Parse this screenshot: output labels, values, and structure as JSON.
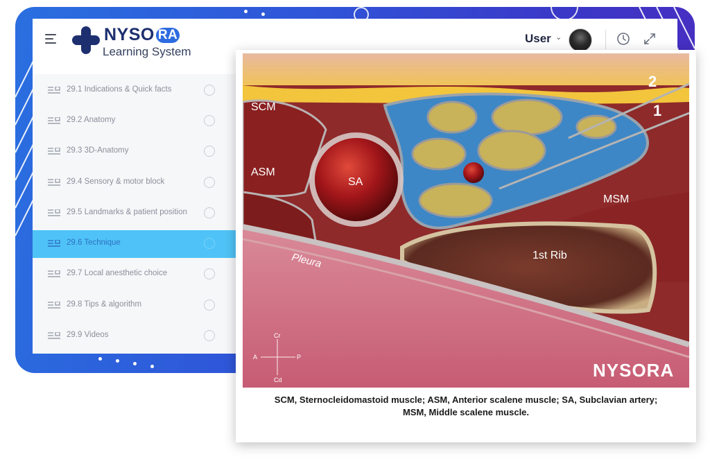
{
  "brand": {
    "name_prefix": "NYSO",
    "name_suffix": "RA",
    "subtitle": "Learning System"
  },
  "header": {
    "user_label": "User",
    "icons": [
      "menu-icon",
      "chevron-down-icon",
      "clock-icon",
      "expand-icon"
    ]
  },
  "sidebar": {
    "active_index": 5,
    "items": [
      {
        "label": "29.1 Indications & Quick facts"
      },
      {
        "label": "29.2 Anatomy"
      },
      {
        "label": "29.3 3D-Anatomy"
      },
      {
        "label": "29.4 Sensory & motor block"
      },
      {
        "label": "29.5 Landmarks & patient position"
      },
      {
        "label": "29.6 Technique"
      },
      {
        "label": "29.7 Local anesthetic choice"
      },
      {
        "label": "29.8 Tips & algorithm"
      },
      {
        "label": "29.9 Videos"
      }
    ]
  },
  "figure": {
    "labels": {
      "scm": "SCM",
      "asm": "ASM",
      "sa": "SA",
      "msm": "MSM",
      "pleura": "Pleura",
      "rib": "1st Rib",
      "needle1": "1",
      "needle2": "2",
      "watermark": "NYSORA",
      "orient_cr": "Cr",
      "orient_cd": "Cd",
      "orient_a": "A",
      "orient_p": "P"
    },
    "caption_line1": "SCM, Sternocleidomastoid muscle; ASM, Anterior scalene muscle; SA, Subclavian artery;",
    "caption_line2": "MSM, Middle scalene muscle."
  },
  "colors": {
    "accent": "#4fc3f7",
    "brand_blue": "#1d2f6f",
    "backdrop_start": "#2a6fe0",
    "backdrop_end": "#4a2cc0"
  }
}
